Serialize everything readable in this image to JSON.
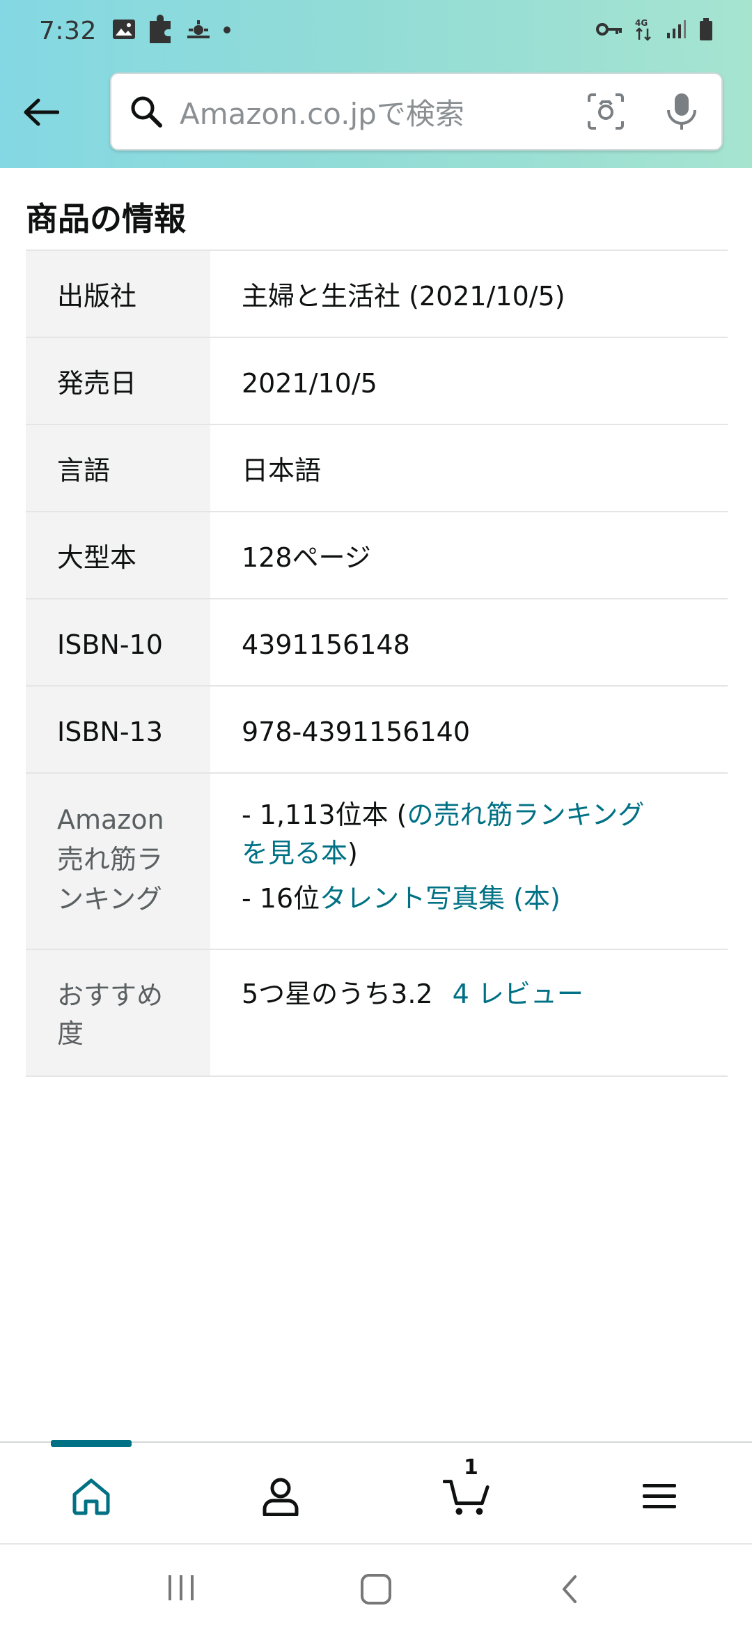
{
  "status_bar": {
    "time": "7:32",
    "network": "4G"
  },
  "search": {
    "placeholder": "Amazon.co.jpで検索"
  },
  "section": {
    "title": "商品の情報"
  },
  "details": {
    "publisher_label": "出版社",
    "publisher_value": "主婦と生活社 (2021/10/5)",
    "release_label": "発売日",
    "release_value": "2021/10/5",
    "language_label": "言語",
    "language_value": "日本語",
    "format_label": "大型本",
    "format_value": "128ページ",
    "isbn10_label": "ISBN-10",
    "isbn10_value": "4391156148",
    "isbn13_label": "ISBN-13",
    "isbn13_value": "978-4391156140",
    "ranking_label_line1": "Amazon",
    "ranking_label_line2": "売れ筋ラ",
    "ranking_label_line3": "ンキング",
    "ranking_line1_prefix": "- 1,113位本 (",
    "ranking_line1_link_a": "の売れ筋ランキング",
    "ranking_line1_link_b": "を見る本",
    "ranking_line1_suffix": ")",
    "ranking_line2_prefix": "- 16位",
    "ranking_line2_link": "タレント写真集 (本)",
    "rating_label_line1": "おすすめ",
    "rating_label_line2": "度",
    "rating_value": "5つ星のうち3.2",
    "review_link": "4 レビュー"
  },
  "bottom_nav": {
    "cart_count": "1"
  },
  "colors": {
    "link": "#007185",
    "accent": "#007185",
    "header_gradient_start": "#84d8e3",
    "header_gradient_end": "#a6e4d0"
  }
}
